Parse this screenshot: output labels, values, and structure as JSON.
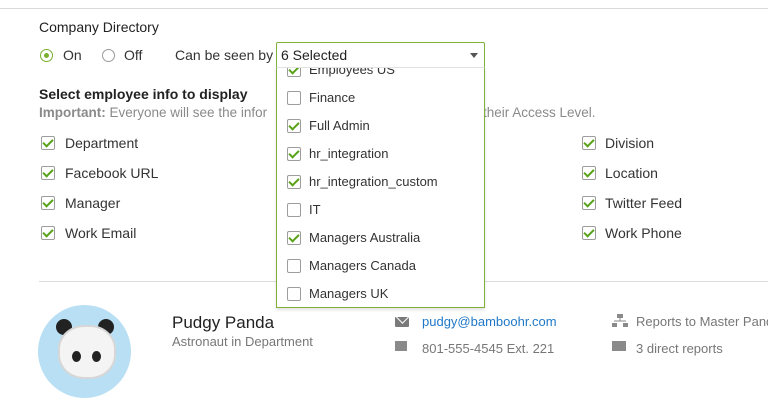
{
  "section": {
    "title": "Company Directory"
  },
  "visibility": {
    "on_label": "On",
    "off_label": "Off",
    "selected": "On",
    "can_be_seen_label": "Can be seen by",
    "select_value": "6 Selected"
  },
  "dropdown_options": [
    {
      "label": "Employees US",
      "checked": true
    },
    {
      "label": "Finance",
      "checked": false
    },
    {
      "label": "Full Admin",
      "checked": true
    },
    {
      "label": "hr_integration",
      "checked": true
    },
    {
      "label": "hr_integration_custom",
      "checked": true
    },
    {
      "label": "IT",
      "checked": false
    },
    {
      "label": "Managers Australia",
      "checked": true
    },
    {
      "label": "Managers Canada",
      "checked": false
    },
    {
      "label": "Managers UK",
      "checked": false
    }
  ],
  "info": {
    "heading": "Select employee info to display",
    "important_label": "Important:",
    "note_left": "Everyone will see the infor",
    "note_right": "their Access Level."
  },
  "fields_left": [
    {
      "label": "Department",
      "checked": true
    },
    {
      "label": "Facebook URL",
      "checked": true
    },
    {
      "label": "Manager",
      "checked": true
    },
    {
      "label": "Work Email",
      "checked": true
    }
  ],
  "fields_right": [
    {
      "label": "Division",
      "checked": true
    },
    {
      "label": "Location",
      "checked": true
    },
    {
      "label": "Twitter Feed",
      "checked": true
    },
    {
      "label": "Work Phone",
      "checked": true
    }
  ],
  "preview": {
    "name": "Pudgy Panda",
    "title": "Astronaut in Department",
    "email": "pudgy@bamboohr.com",
    "phone": "801-555-4545 Ext. 221",
    "reports_to": "Reports to Master Pand",
    "direct_reports": "3 direct reports"
  },
  "colors": {
    "accent": "#77b02c",
    "link": "#1f78c8"
  }
}
